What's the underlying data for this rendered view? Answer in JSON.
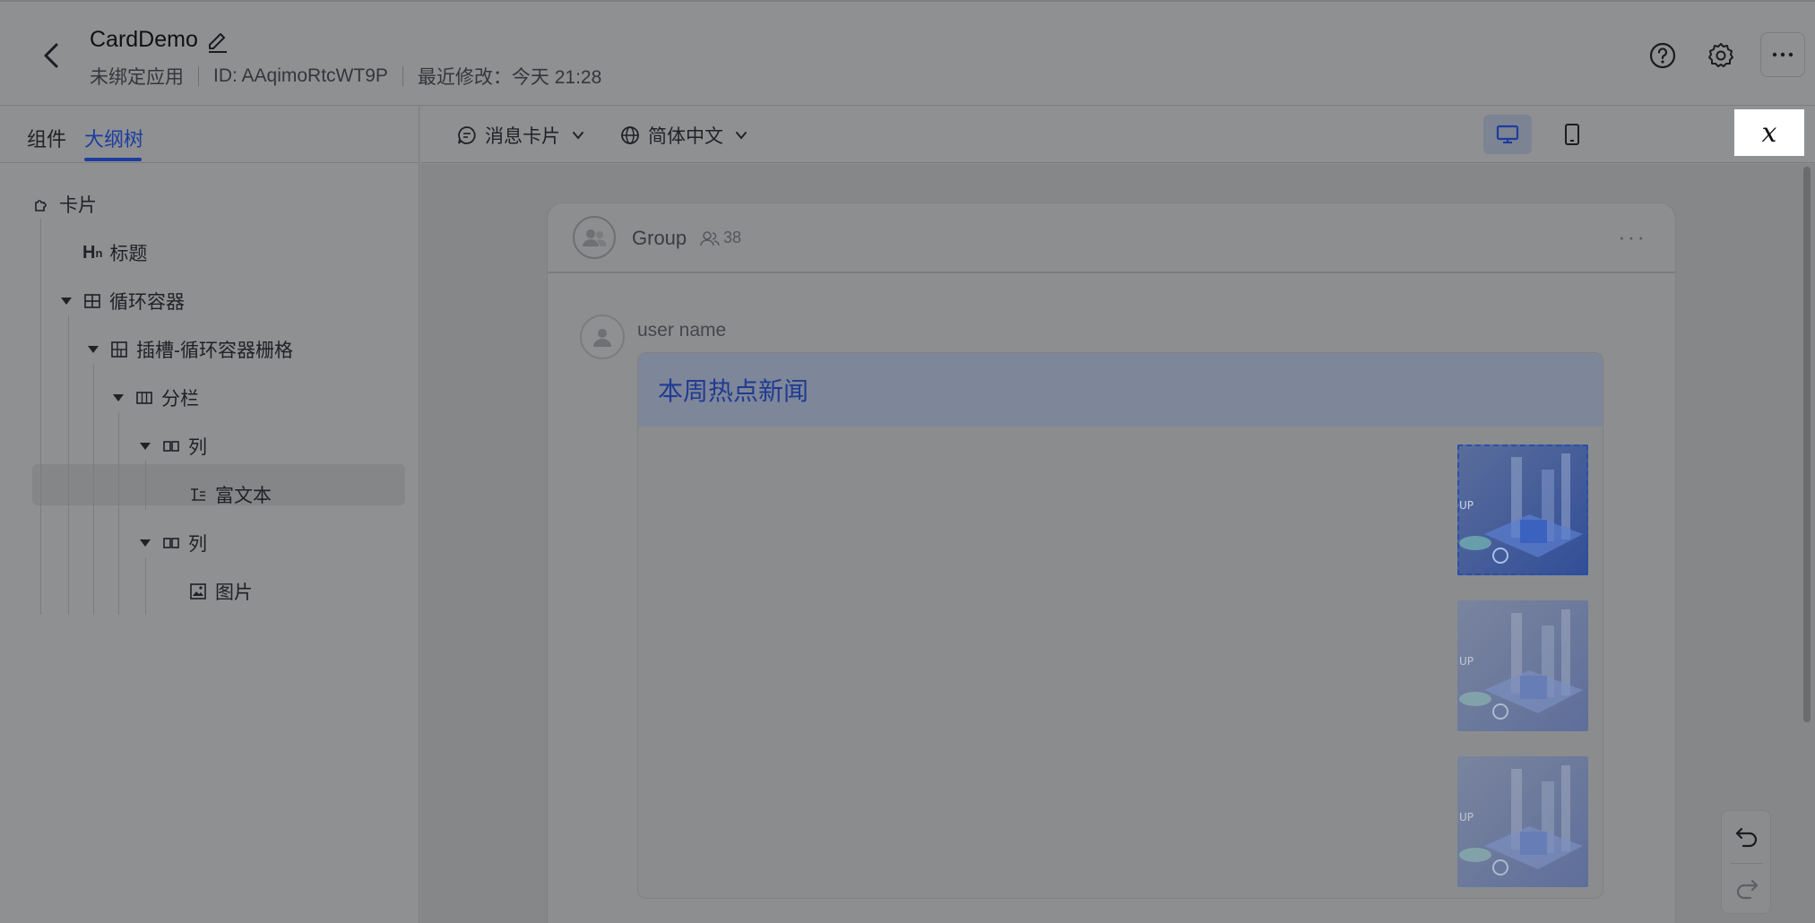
{
  "header": {
    "title": "CardDemo",
    "binding": "未绑定应用",
    "id_text": "ID: AAqimoRtcWT9P",
    "modified_text": "最近修改：今天 21:28"
  },
  "left_tabs": [
    {
      "label": "组件"
    },
    {
      "label": "大纲树"
    }
  ],
  "tree": {
    "card": "卡片",
    "title": "标题",
    "loop": "循环容器",
    "slot": "插槽-循环容器栅格",
    "columns": "分栏",
    "col1": "列",
    "richtext": "富文本",
    "col2": "列",
    "image": "图片"
  },
  "toolbar": {
    "card_type": "消息卡片",
    "language": "简体中文",
    "variable_symbol": "𝑥"
  },
  "preview": {
    "group_name": "Group",
    "member_count": "38",
    "user_name": "user name",
    "card_title": "本周热点新闻"
  },
  "colors": {
    "accent": "#1c3d9e",
    "card_header_bg": "#7e8699"
  }
}
